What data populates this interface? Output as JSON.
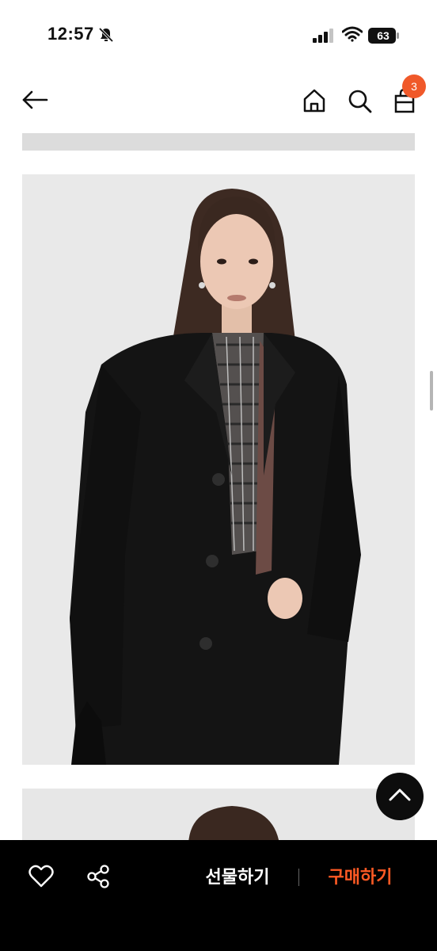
{
  "status_bar": {
    "time": "12:57",
    "battery": "63",
    "icons": [
      "bell-slash-icon",
      "cellular-signal-icon",
      "wifi-icon",
      "battery-icon"
    ]
  },
  "header": {
    "icons": [
      "back-arrow-icon",
      "home-icon",
      "search-icon",
      "shopping-bag-icon"
    ],
    "cart_count": "3",
    "badge_color": "#f0592a"
  },
  "content": {
    "images": [
      "product-photo-strip",
      "product-photo-model-black-coat",
      "product-photo-next"
    ]
  },
  "floating": {
    "icon": "chevron-up-icon"
  },
  "bottom_bar": {
    "like_icon": "heart-icon",
    "share_icon": "share-icon",
    "gift_label": "선물하기",
    "buy_label": "구매하기",
    "buy_color": "#ff5a24"
  }
}
